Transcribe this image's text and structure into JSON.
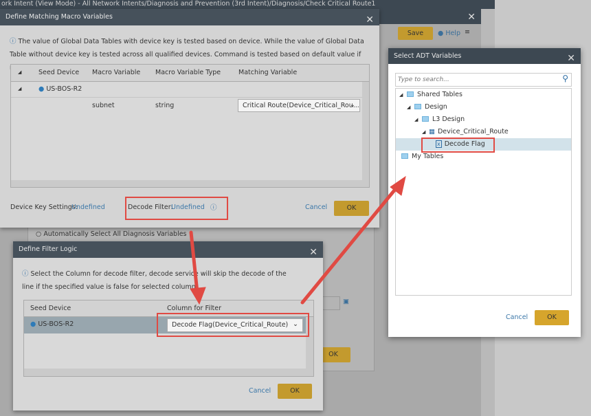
{
  "background": {
    "window_title": "ork Intent (View Mode) - All Network Intents/Diagnosis and Prevention (3rd Intent)/Diagnosis/Check Critical Route1",
    "save_label": "Save",
    "help_label": "Help",
    "radio_label": "Automatically Select All Diagnosis Variables",
    "ok_label": "OK"
  },
  "macro_dialog": {
    "title": "Define Matching Macro Variables",
    "info": "The value of Global Data Tables with device key is tested based on device. While the value of Global Data Table without device key is tested across all qualified devices. Command is tested based on default value if no matching variable.",
    "columns": [
      "Seed Device",
      "Macro Variable",
      "Macro Variable Type",
      "Matching Variable"
    ],
    "device": "US-BOS-R2",
    "rows": [
      {
        "macro_variable": "subnet",
        "type": "string",
        "matching_variable": "Critical Route(Device_Critical_Rou..."
      }
    ],
    "device_key_label": "Device Key Settings:",
    "device_key_value": "Undefined",
    "decode_filter_label": "Decode Filter:",
    "decode_filter_value": "Undefined",
    "cancel_label": "Cancel",
    "ok_label": "OK"
  },
  "filter_dialog": {
    "title": "Define Filter Logic",
    "info": "Select the Column for decode filter, decode service will skip the decode of the line if the specified value is false for selected column.",
    "columns": [
      "Seed Device",
      "Column for Filter"
    ],
    "device": "US-BOS-R2",
    "column_value": "Decode Flag(Device_Critical_Route)",
    "cancel_label": "Cancel",
    "ok_label": "OK"
  },
  "adt_dialog": {
    "title": "Select ADT Variables",
    "search_placeholder": "Type to search...",
    "tree": [
      "Shared Tables",
      "Design",
      "L3 Design",
      "Device_Critical_Route",
      "Decode Flag",
      "My Tables"
    ],
    "cancel_label": "Cancel",
    "ok_label": "OK"
  },
  "colors": {
    "accent": "#d6a52c",
    "annotation": "#e04a43",
    "titlebar": "#3d4852"
  }
}
